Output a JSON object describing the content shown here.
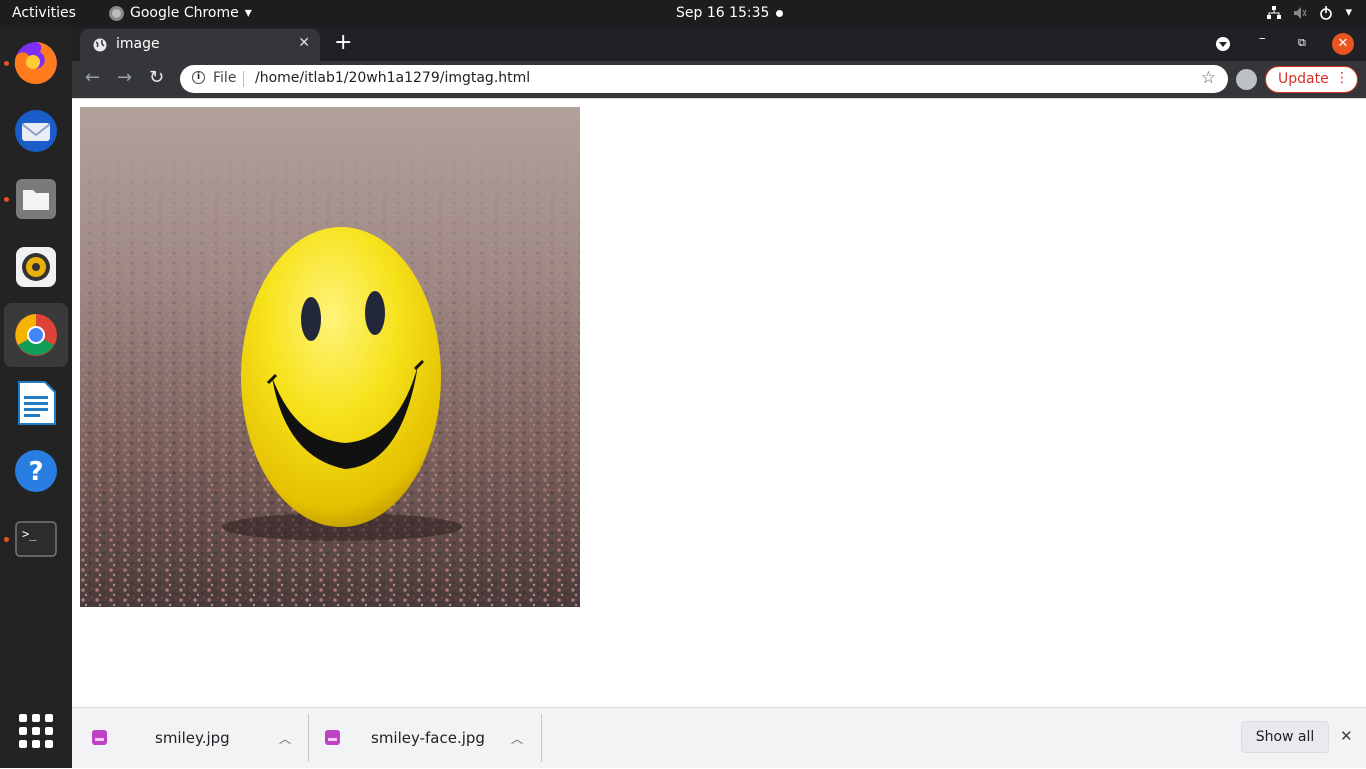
{
  "topbar": {
    "activities": "Activities",
    "app_name": "Google Chrome",
    "clock": "Sep 16  15:35"
  },
  "dock": {
    "items": [
      "Firefox",
      "Thunderbird",
      "Files",
      "Rhythmbox",
      "Google Chrome",
      "LibreOffice Writer",
      "Help",
      "Terminal"
    ],
    "apps_grid": "Show Applications"
  },
  "browser": {
    "tab_title": "image",
    "omnibox": {
      "scheme": "File",
      "url": "/home/itlab1/20wh1a1279/imgtag.html"
    },
    "update_label": "Update"
  },
  "downloads": {
    "items": [
      {
        "name": "smiley.jpg"
      },
      {
        "name": "smiley-face.jpg"
      }
    ],
    "show_all": "Show all"
  },
  "colors": {
    "ubuntu_orange": "#e95420",
    "update_red": "#d93025",
    "smiley_yellow": "#f2dc10"
  }
}
